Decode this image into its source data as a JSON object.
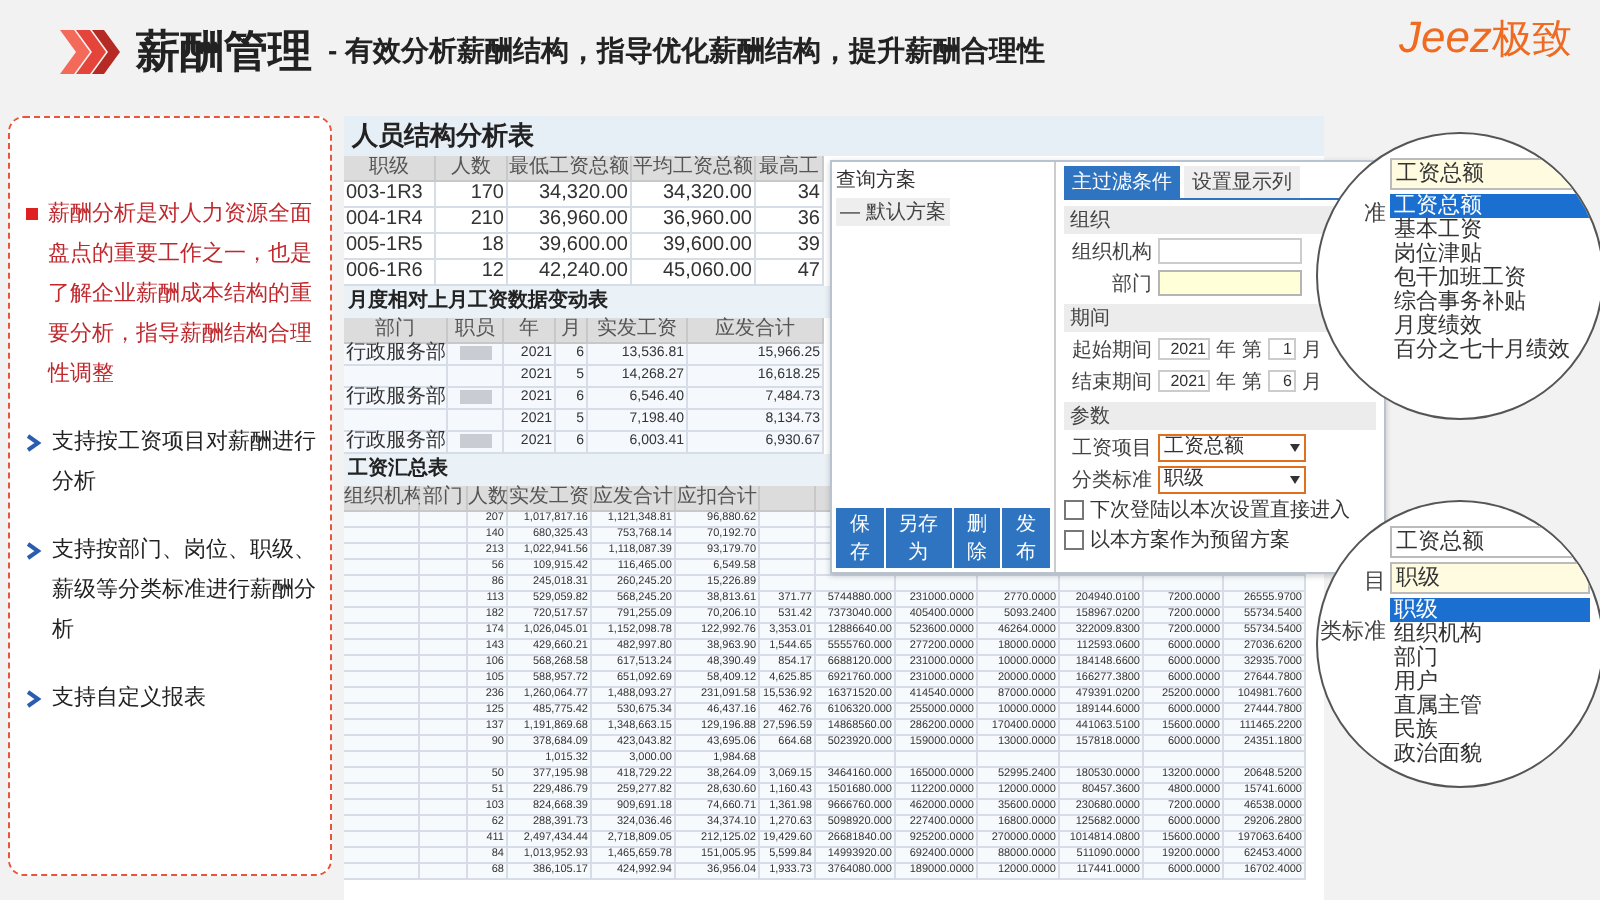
{
  "header": {
    "title": "薪酬管理",
    "subtitle": "- 有效分析薪酬结构，指导优化薪酬结构，提升薪酬合理性",
    "logo": {
      "latin": "Jeez",
      "cjk": "极致"
    }
  },
  "points": [
    {
      "kind": "note",
      "text": "薪酬分析是对人力资源全面盘点的重要工作之一，也是了解企业薪酬成本结构的重要分析，指导薪酬结构合理性调整"
    },
    {
      "kind": "feature",
      "text": "支持按工资项目对薪酬进行分析"
    },
    {
      "kind": "feature",
      "text": "支持按部门、岗位、职级、薪级等分类标准进行薪酬分析"
    },
    {
      "kind": "feature",
      "text": "支持自定义报表"
    }
  ],
  "structure_table": {
    "title": "人员结构分析表",
    "columns": [
      "职级",
      "人数",
      "最低工资总额",
      "平均工资总额",
      "最高工"
    ],
    "rows": [
      [
        "003-1R3",
        "170",
        "34,320.00",
        "34,320.00",
        "34"
      ],
      [
        "004-1R4",
        "210",
        "36,960.00",
        "36,960.00",
        "36"
      ],
      [
        "005-1R5",
        "18",
        "39,600.00",
        "39,600.00",
        "39"
      ],
      [
        "006-1R6",
        "12",
        "42,240.00",
        "45,060.00",
        "47"
      ]
    ]
  },
  "change_table": {
    "title": "月度相对上月工资数据变动表",
    "columns": [
      "部门",
      "职员",
      "年",
      "月",
      "实发工资",
      "应发合计"
    ],
    "rows": [
      {
        "redacted": true,
        "cells": [
          "行政服务部",
          "",
          "2021",
          "6",
          "13,536.81",
          "15,966.25"
        ]
      },
      {
        "redacted": false,
        "cells": [
          "",
          "",
          "2021",
          "5",
          "14,268.27",
          "16,618.25"
        ]
      },
      {
        "redacted": true,
        "cells": [
          "行政服务部",
          "",
          "2021",
          "6",
          "6,546.40",
          "7,484.73"
        ]
      },
      {
        "redacted": false,
        "cells": [
          "",
          "",
          "2021",
          "5",
          "7,198.40",
          "8,134.73"
        ]
      },
      {
        "redacted": true,
        "cells": [
          "行政服务部",
          "",
          "2021",
          "6",
          "6,003.41",
          "6,930.67"
        ]
      }
    ]
  },
  "summary_table": {
    "title": "工资汇总表",
    "columns": [
      "组织机构",
      "部门",
      "人数",
      "实发工资",
      "应发合计",
      "应扣合计"
    ],
    "rows": [
      [
        "",
        "",
        "207",
        "1,017,817.16",
        "1,121,348.81",
        "96,880.62",
        "",
        "",
        "",
        "",
        "",
        "",
        ""
      ],
      [
        "",
        "",
        "140",
        "680,325.43",
        "753,768.14",
        "70,192.70",
        "",
        "",
        "",
        "",
        "",
        "",
        ""
      ],
      [
        "",
        "",
        "213",
        "1,022,941.56",
        "1,118,087.39",
        "93,179.70",
        "",
        "",
        "",
        "",
        "",
        "",
        ""
      ],
      [
        "",
        "",
        "56",
        "109,915.42",
        "116,465.00",
        "6,549.58",
        "",
        "",
        "",
        "",
        "",
        "",
        ""
      ],
      [
        "",
        "",
        "86",
        "245,018.31",
        "260,245.20",
        "15,226.89",
        "",
        "",
        "",
        "",
        "",
        "",
        ""
      ],
      [
        "",
        "",
        "113",
        "529,059.82",
        "568,245.20",
        "38,813.61",
        "371.77",
        "5744880.000",
        "231000.0000",
        "2770.0000",
        "204940.0100",
        "7200.0000",
        "26555.9700"
      ],
      [
        "",
        "",
        "182",
        "720,517.57",
        "791,255.09",
        "70,206.10",
        "531.42",
        "7373040.000",
        "405400.0000",
        "5093.2400",
        "158967.0200",
        "7200.0000",
        "55734.5400"
      ],
      [
        "",
        "",
        "174",
        "1,026,045.01",
        "1,152,098.78",
        "122,992.76",
        "3,353.01",
        "12886640.00",
        "523600.0000",
        "46264.0000",
        "322009.8300",
        "7200.0000",
        "55734.5400"
      ],
      [
        "",
        "",
        "143",
        "429,660.21",
        "482,997.80",
        "38,963.90",
        "1,544.65",
        "5555760.000",
        "277200.0000",
        "18000.0000",
        "112593.0600",
        "6000.0000",
        "27036.6200"
      ],
      [
        "",
        "",
        "106",
        "568,268.58",
        "617,513.24",
        "48,390.49",
        "854.17",
        "6688120.000",
        "231000.0000",
        "10000.0000",
        "184148.6600",
        "6000.0000",
        "32935.7000"
      ],
      [
        "",
        "",
        "105",
        "588,957.72",
        "651,092.69",
        "58,409.12",
        "4,625.85",
        "6921760.000",
        "231000.0000",
        "20000.0000",
        "166277.3800",
        "6000.0000",
        "27644.7800"
      ],
      [
        "",
        "",
        "236",
        "1,260,064.77",
        "1,488,093.27",
        "231,091.58",
        "15,536.92",
        "16371520.00",
        "414540.0000",
        "87000.0000",
        "479391.0200",
        "25200.0000",
        "104981.7600"
      ],
      [
        "",
        "",
        "125",
        "485,775.42",
        "530,675.34",
        "46,437.16",
        "462.76",
        "6106320.000",
        "255000.0000",
        "10000.0000",
        "189144.6000",
        "6000.0000",
        "27444.7800"
      ],
      [
        "",
        "",
        "137",
        "1,191,869.68",
        "1,348,663.15",
        "129,196.88",
        "27,596.59",
        "14868560.00",
        "286200.0000",
        "170400.0000",
        "441063.5100",
        "15600.0000",
        "111465.2200"
      ],
      [
        "",
        "",
        "90",
        "378,684.09",
        "423,043.82",
        "43,695.06",
        "664.68",
        "5023920.000",
        "159000.0000",
        "13000.0000",
        "157818.0000",
        "6000.0000",
        "24351.1800"
      ],
      [
        "",
        "",
        "",
        "1,015.32",
        "3,000.00",
        "1,984.68",
        "",
        "",
        "",
        "",
        "",
        "",
        ""
      ],
      [
        "",
        "",
        "50",
        "377,195.98",
        "418,729.22",
        "38,264.09",
        "3,069.15",
        "3464160.000",
        "165000.0000",
        "52995.2400",
        "180530.0000",
        "13200.0000",
        "20648.5200"
      ],
      [
        "",
        "",
        "51",
        "229,486.79",
        "259,277.82",
        "28,630.60",
        "1,160.43",
        "1501680.000",
        "112200.0000",
        "12000.0000",
        "80457.3600",
        "4800.0000",
        "15741.6000"
      ],
      [
        "",
        "",
        "103",
        "824,668.39",
        "909,691.18",
        "74,660.71",
        "1,361.98",
        "9666760.000",
        "462000.0000",
        "35600.0000",
        "230680.0000",
        "7200.0000",
        "46538.0000"
      ],
      [
        "",
        "",
        "62",
        "288,391.73",
        "324,036.46",
        "34,374.10",
        "1,270.63",
        "5098920.000",
        "227400.0000",
        "16800.0000",
        "125682.0000",
        "6000.0000",
        "29206.2800"
      ],
      [
        "",
        "",
        "411",
        "2,497,434.44",
        "2,718,809.05",
        "212,125.02",
        "19,429.60",
        "26681840.00",
        "925200.0000",
        "270000.0000",
        "1014814.0800",
        "15600.0000",
        "197063.6400"
      ],
      [
        "",
        "",
        "84",
        "1,013,952.93",
        "1,465,659.78",
        "151,005.95",
        "5,599.84",
        "14993920.00",
        "692400.0000",
        "88000.0000",
        "511090.0000",
        "19200.0000",
        "62453.4000"
      ],
      [
        "",
        "",
        "68",
        "386,105.17",
        "424,992.94",
        "36,956.04",
        "1,933.73",
        "3764080.000",
        "189000.0000",
        "12000.0000",
        "117441.0000",
        "6000.0000",
        "16702.4000"
      ]
    ]
  },
  "query_dialog": {
    "scheme_title": "查询方案",
    "schemes": [
      {
        "label": "— 默认方案",
        "selected": false
      }
    ],
    "buttons": [
      "保存",
      "另存为",
      "删除",
      "发布"
    ],
    "tabs": [
      {
        "label": "主过滤条件",
        "selected": true
      },
      {
        "label": "设置显示列",
        "selected": false
      }
    ],
    "sections": [
      {
        "title": "组织",
        "fields": [
          {
            "kind": "text",
            "label": "组织机构",
            "focused": false
          },
          {
            "kind": "text",
            "label": "部门",
            "focused": true
          }
        ]
      },
      {
        "title": "期间",
        "fields": [
          {
            "kind": "period",
            "label": "起始期间",
            "year": "2021",
            "year_unit": "年",
            "prefix": "第",
            "month": "1",
            "month_unit": "月"
          },
          {
            "kind": "period",
            "label": "结束期间",
            "year": "2021",
            "year_unit": "年",
            "prefix": "第",
            "month": "6",
            "month_unit": "月"
          }
        ]
      },
      {
        "title": "参数",
        "fields": [
          {
            "kind": "select",
            "label": "工资项目",
            "value": "工资总额",
            "highlighted": true
          },
          {
            "kind": "select",
            "label": "分类标准",
            "value": "职级",
            "highlighted": true
          }
        ]
      }
    ],
    "options": [
      {
        "label": "下次登陆以本次设置直接进入",
        "checked": false
      },
      {
        "label": "以本方案作为预留方案",
        "checked": false
      }
    ]
  },
  "magnifiers": [
    {
      "fragments": [
        "准"
      ],
      "fields": [
        {
          "value": "工资总额",
          "active": true
        }
      ],
      "list": [
        {
          "label": "工资总额",
          "selected": true
        },
        {
          "label": "基本工资",
          "selected": false
        },
        {
          "label": "岗位津贴",
          "selected": false
        },
        {
          "label": "包干加班工资",
          "selected": false
        },
        {
          "label": "综合事务补贴",
          "selected": false
        },
        {
          "label": "月度绩效",
          "selected": false
        },
        {
          "label": "百分之七十月绩效",
          "selected": false
        }
      ]
    },
    {
      "fragments": [
        "目",
        "类标准"
      ],
      "fields": [
        {
          "value": "工资总额",
          "active": false
        },
        {
          "value": "职级",
          "active": true
        }
      ],
      "list": [
        {
          "label": "职级",
          "selected": true
        },
        {
          "label": "组织机构",
          "selected": false
        },
        {
          "label": "部门",
          "selected": false
        },
        {
          "label": "用户",
          "selected": false
        },
        {
          "label": "直属主管",
          "selected": false
        },
        {
          "label": "民族",
          "selected": false
        },
        {
          "label": "政治面貌",
          "selected": false
        }
      ]
    }
  ]
}
